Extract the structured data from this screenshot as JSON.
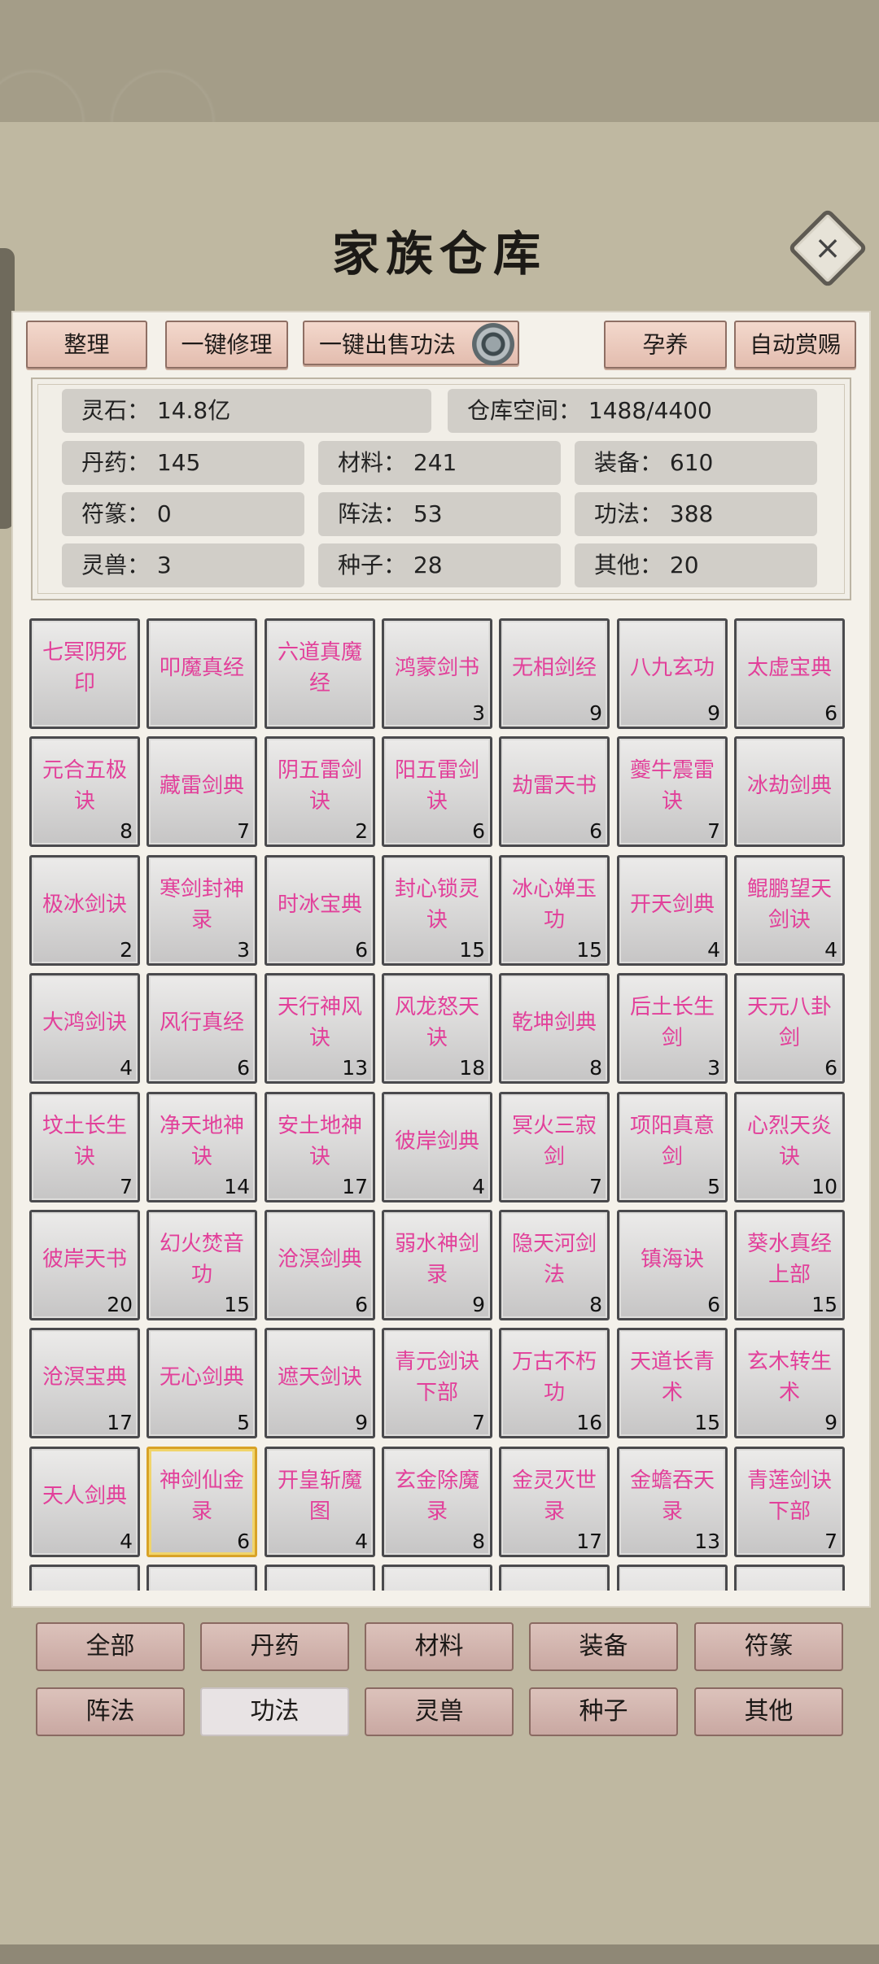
{
  "title": "家族仓库",
  "close_icon": "×",
  "toolbar": {
    "sort": "整理",
    "repair_all": "一键修理",
    "sell_skills": "一键出售功法",
    "breed": "孕养",
    "auto_reward": "自动赏赐"
  },
  "stats": {
    "spirit_stone": "灵石：  14.8亿",
    "storage": "仓库空间：    1488/4400",
    "pills": "丹药：  145",
    "materials": "材料：  241",
    "equipment": "装备：  610",
    "talismans": "符篆：  0",
    "formations": "阵法：  53",
    "skills": "功法：  388",
    "beasts": "灵兽：  3",
    "seeds": "种子：  28",
    "others": "其他：  20"
  },
  "items": [
    {
      "name": "七冥阴死印",
      "qty": ""
    },
    {
      "name": "叩魔真经",
      "qty": ""
    },
    {
      "name": "六道真魔经",
      "qty": ""
    },
    {
      "name": "鸿蒙剑书",
      "qty": "3"
    },
    {
      "name": "无相剑经",
      "qty": "9"
    },
    {
      "name": "八九玄功",
      "qty": "9"
    },
    {
      "name": "太虚宝典",
      "qty": "6"
    },
    {
      "name": "元合五极诀",
      "qty": "8"
    },
    {
      "name": "藏雷剑典",
      "qty": "7"
    },
    {
      "name": "阴五雷剑诀",
      "qty": "2"
    },
    {
      "name": "阳五雷剑诀",
      "qty": "6"
    },
    {
      "name": "劫雷天书",
      "qty": "6"
    },
    {
      "name": "夔牛震雷诀",
      "qty": "7"
    },
    {
      "name": "冰劫剑典",
      "qty": ""
    },
    {
      "name": "极冰剑诀",
      "qty": "2"
    },
    {
      "name": "寒剑封神录",
      "qty": "3"
    },
    {
      "name": "时冰宝典",
      "qty": "6"
    },
    {
      "name": "封心锁灵诀",
      "qty": "15"
    },
    {
      "name": "冰心婵玉功",
      "qty": "15"
    },
    {
      "name": "开天剑典",
      "qty": "4"
    },
    {
      "name": "鲲鹏望天剑诀",
      "qty": "4"
    },
    {
      "name": "大鸿剑诀",
      "qty": "4"
    },
    {
      "name": "风行真经",
      "qty": "6"
    },
    {
      "name": "天行神风诀",
      "qty": "13"
    },
    {
      "name": "风龙怒天诀",
      "qty": "18"
    },
    {
      "name": "乾坤剑典",
      "qty": "8"
    },
    {
      "name": "后土长生剑",
      "qty": "3"
    },
    {
      "name": "天元八卦剑",
      "qty": "6"
    },
    {
      "name": "坟土长生诀",
      "qty": "7"
    },
    {
      "name": "净天地神诀",
      "qty": "14"
    },
    {
      "name": "安土地神诀",
      "qty": "17"
    },
    {
      "name": "彼岸剑典",
      "qty": "4"
    },
    {
      "name": "冥火三寂剑",
      "qty": "7"
    },
    {
      "name": "项阳真意剑",
      "qty": "5"
    },
    {
      "name": "心烈天炎诀",
      "qty": "10"
    },
    {
      "name": "彼岸天书",
      "qty": "20"
    },
    {
      "name": "幻火焚音功",
      "qty": "15"
    },
    {
      "name": "沧溟剑典",
      "qty": "6"
    },
    {
      "name": "弱水神剑录",
      "qty": "9"
    },
    {
      "name": "隐天河剑法",
      "qty": "8"
    },
    {
      "name": "镇海诀",
      "qty": "6"
    },
    {
      "name": "葵水真经上部",
      "qty": "15"
    },
    {
      "name": "沧溟宝典",
      "qty": "17"
    },
    {
      "name": "无心剑典",
      "qty": "5"
    },
    {
      "name": "遮天剑诀",
      "qty": "9"
    },
    {
      "name": "青元剑诀下部",
      "qty": "7"
    },
    {
      "name": "万古不朽功",
      "qty": "16"
    },
    {
      "name": "天道长青术",
      "qty": "15"
    },
    {
      "name": "玄木转生术",
      "qty": "9"
    },
    {
      "name": "天人剑典",
      "qty": "4"
    },
    {
      "name": "神剑仙金录",
      "qty": "6"
    },
    {
      "name": "开皇斩魔图",
      "qty": "4"
    },
    {
      "name": "玄金除魔录",
      "qty": "8"
    },
    {
      "name": "金灵灭世录",
      "qty": "17"
    },
    {
      "name": "金蟾吞天录",
      "qty": "13"
    },
    {
      "name": "青莲剑诀下部",
      "qty": "7"
    }
  ],
  "selected_index": 50,
  "categories": [
    "全部",
    "丹药",
    "材料",
    "装备",
    "符篆",
    "阵法",
    "功法",
    "灵兽",
    "种子",
    "其他"
  ],
  "active_category": 6
}
